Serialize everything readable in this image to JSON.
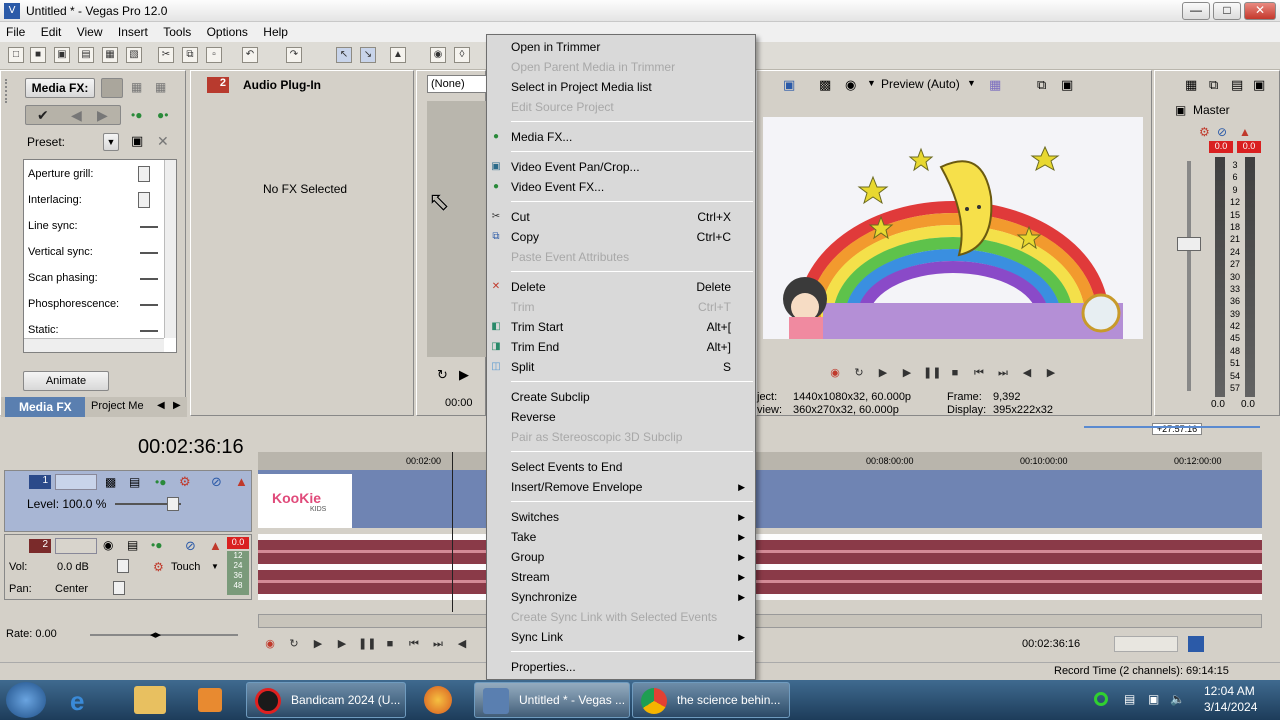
{
  "window": {
    "title": "Untitled * - Vegas Pro 12.0",
    "minimize": "—",
    "maximize": "□",
    "close": "✕"
  },
  "menu": [
    "File",
    "Edit",
    "View",
    "Insert",
    "Tools",
    "Options",
    "Help"
  ],
  "mediafx": {
    "title": "Media FX:",
    "preset_label": "Preset:",
    "params": [
      "Aperture grill:",
      "Interlacing:",
      "Line sync:",
      "Vertical sync:",
      "Scan phasing:",
      "Phosphorescence:",
      "Static:"
    ],
    "animate": "Animate",
    "tab_media_fx": "Media FX",
    "tab_project_media": "Project Me"
  },
  "audio_plugin": {
    "badge": "2",
    "title": "Audio Plug-In",
    "no_fx": "No FX Selected"
  },
  "trimmer": {
    "dropdown": "(None)",
    "time": "00:00"
  },
  "preview": {
    "quality": "Preview (Auto)",
    "project_label": "ject:",
    "project_value": "1440x1080x32, 60.000p",
    "preview_label": "view:",
    "preview_value": "360x270x32, 60.000p",
    "frame_label": "Frame:",
    "frame_value": "9,392",
    "display_label": "Display:",
    "display_value": "395x222x32"
  },
  "master": {
    "title": "Master",
    "peak_left": "0.0",
    "peak_right": "0.0",
    "scale": [
      "3",
      "6",
      "9",
      "12",
      "15",
      "18",
      "21",
      "24",
      "27",
      "30",
      "33",
      "36",
      "39",
      "42",
      "45",
      "48",
      "51",
      "54",
      "57"
    ],
    "bottom_left": "0.0",
    "bottom_right": "0.0"
  },
  "timeline": {
    "current_time": "00:02:36:16",
    "ruler_marks": [
      "00:02:00",
      "00:08:00:00",
      "00:10:00:00",
      "00:12:00:00"
    ],
    "loop_region": "+27:57:16",
    "track1": {
      "number": "1",
      "level": "Level: 100.0 %",
      "clip_text": "KooKie",
      "clip_sub": "KIDS"
    },
    "track2": {
      "number": "2",
      "peak": "0.0",
      "vol_label": "Vol:",
      "vol_value": "0.0 dB",
      "pan_label": "Pan:",
      "pan_value": "Center",
      "automation": "Touch",
      "mini_scale": [
        "12",
        "24",
        "36",
        "48"
      ]
    },
    "rate": "Rate: 0.00",
    "end_time": "00:02:36:16",
    "record_time": "Record Time (2 channels): 69:14:15"
  },
  "context_menu": {
    "items": [
      {
        "label": "Open in Trimmer",
        "disabled": false,
        "shortcut": "",
        "submenu": false,
        "icon": ""
      },
      {
        "label": "Open Parent Media in Trimmer",
        "disabled": true,
        "shortcut": "",
        "submenu": false,
        "icon": ""
      },
      {
        "label": "Select in Project Media list",
        "disabled": false,
        "shortcut": "",
        "submenu": false,
        "icon": ""
      },
      {
        "label": "Edit Source Project",
        "disabled": true,
        "shortcut": "",
        "submenu": false,
        "icon": ""
      },
      {
        "sep": true
      },
      {
        "label": "Media FX...",
        "disabled": false,
        "shortcut": "",
        "submenu": false,
        "icon": "fx-icon"
      },
      {
        "sep": true
      },
      {
        "label": "Video Event Pan/Crop...",
        "disabled": false,
        "shortcut": "",
        "submenu": false,
        "icon": "pan-crop-icon"
      },
      {
        "label": "Video Event FX...",
        "disabled": false,
        "shortcut": "",
        "submenu": false,
        "icon": "fx-icon"
      },
      {
        "sep": true
      },
      {
        "label": "Cut",
        "disabled": false,
        "shortcut": "Ctrl+X",
        "submenu": false,
        "icon": "scissors-icon"
      },
      {
        "label": "Copy",
        "disabled": false,
        "shortcut": "Ctrl+C",
        "submenu": false,
        "icon": "copy-icon"
      },
      {
        "label": "Paste Event Attributes",
        "disabled": true,
        "shortcut": "",
        "submenu": false,
        "icon": ""
      },
      {
        "sep": true
      },
      {
        "label": "Delete",
        "disabled": false,
        "shortcut": "Delete",
        "submenu": false,
        "icon": "delete-icon"
      },
      {
        "label": "Trim",
        "disabled": true,
        "shortcut": "Ctrl+T",
        "submenu": false,
        "icon": ""
      },
      {
        "label": "Trim Start",
        "disabled": false,
        "shortcut": "Alt+[",
        "submenu": false,
        "icon": "trim-start-icon"
      },
      {
        "label": "Trim End",
        "disabled": false,
        "shortcut": "Alt+]",
        "submenu": false,
        "icon": "trim-end-icon"
      },
      {
        "label": "Split",
        "disabled": false,
        "shortcut": "S",
        "submenu": false,
        "icon": "split-icon"
      },
      {
        "sep": true
      },
      {
        "label": "Create Subclip",
        "disabled": false,
        "shortcut": "",
        "submenu": false,
        "icon": ""
      },
      {
        "label": "Reverse",
        "disabled": false,
        "shortcut": "",
        "submenu": false,
        "icon": ""
      },
      {
        "label": "Pair as Stereoscopic 3D Subclip",
        "disabled": true,
        "shortcut": "",
        "submenu": false,
        "icon": ""
      },
      {
        "sep": true
      },
      {
        "label": "Select Events to End",
        "disabled": false,
        "shortcut": "",
        "submenu": false,
        "icon": ""
      },
      {
        "label": "Insert/Remove Envelope",
        "disabled": false,
        "shortcut": "",
        "submenu": true,
        "icon": ""
      },
      {
        "sep": true
      },
      {
        "label": "Switches",
        "disabled": false,
        "shortcut": "",
        "submenu": true,
        "icon": ""
      },
      {
        "label": "Take",
        "disabled": false,
        "shortcut": "",
        "submenu": true,
        "icon": ""
      },
      {
        "label": "Group",
        "disabled": false,
        "shortcut": "",
        "submenu": true,
        "icon": ""
      },
      {
        "label": "Stream",
        "disabled": false,
        "shortcut": "",
        "submenu": true,
        "icon": ""
      },
      {
        "label": "Synchronize",
        "disabled": false,
        "shortcut": "",
        "submenu": true,
        "icon": ""
      },
      {
        "label": "Create Sync Link with Selected Events",
        "disabled": true,
        "shortcut": "",
        "submenu": false,
        "icon": ""
      },
      {
        "label": "Sync Link",
        "disabled": false,
        "shortcut": "",
        "submenu": true,
        "icon": ""
      },
      {
        "sep": true
      },
      {
        "label": "Properties...",
        "disabled": false,
        "shortcut": "",
        "submenu": false,
        "icon": ""
      }
    ]
  },
  "taskbar": {
    "tasks": [
      {
        "label": "Bandicam 2024 (U...",
        "icon_color": "#1a1a1a"
      },
      {
        "label": "Untitled * - Vegas ...",
        "icon_color": "#5a7fb0"
      },
      {
        "label": "the science behin...",
        "icon_color": "#e0a030"
      }
    ],
    "time": "12:04 AM",
    "date": "3/14/2024"
  },
  "colors": {
    "accent_red": "#c0392b",
    "track_blue": "#6f84b3",
    "waveform": "#8a3a48",
    "menu_bg": "#d9d9d9"
  }
}
